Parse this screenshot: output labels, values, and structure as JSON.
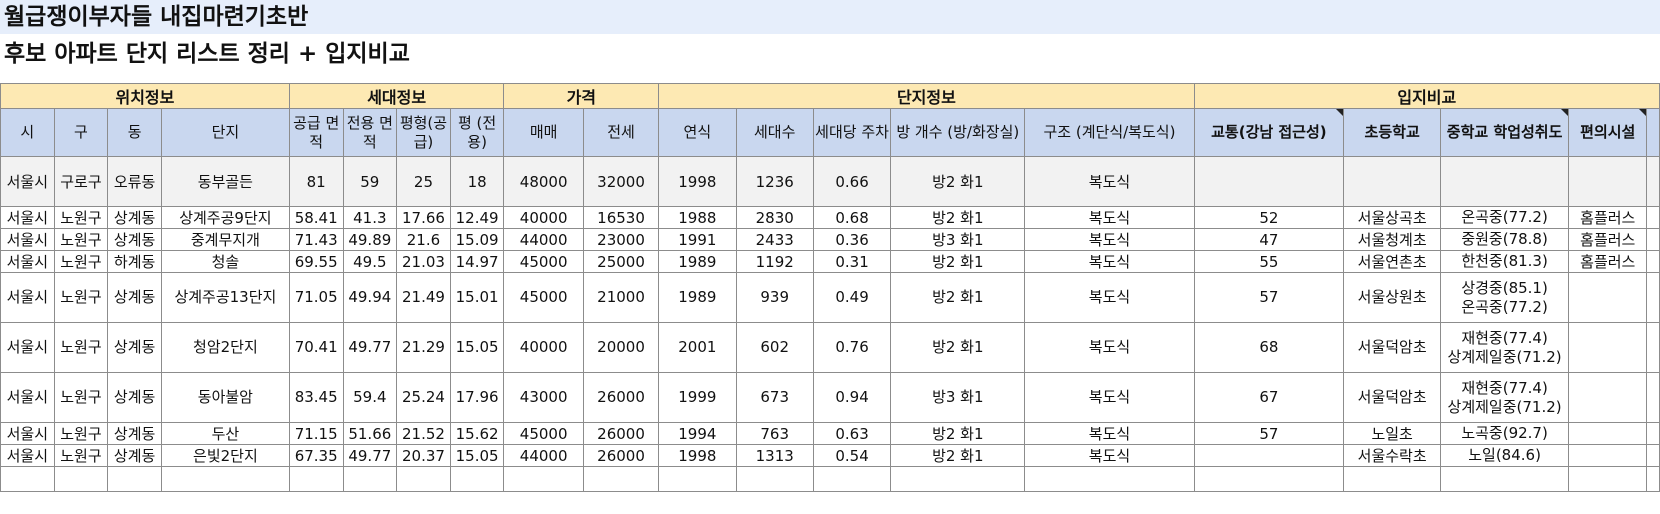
{
  "sheet": {
    "title1": "월급쟁이부자들 내집마련기초반",
    "title2": "후보 아파트 단지 리스트 정리 + 입지비교"
  },
  "groups": {
    "location": "위치정보",
    "household": "세대정보",
    "price": "가격",
    "complex": "단지정보",
    "compare": "입지비교"
  },
  "headers": {
    "si": "시",
    "gu": "구",
    "dong": "동",
    "danji": "단지",
    "supply_area": "공급 면적",
    "exclusive_area": "전용 면적",
    "pyeong_supply": "평형(공급)",
    "pyeong_exclusive": "평 (전용)",
    "sale": "매매",
    "jeonse": "전세",
    "year": "연식",
    "households": "세대수",
    "parking": "세대당 주차",
    "rooms": "방 개수 (방/화장실)",
    "structure": "구조 (계단식/복도식)",
    "transport": "교통(강남 접근성)",
    "elementary": "초등학교",
    "middle": "중학교 학업성취도",
    "convenience": "편의시설"
  },
  "rows": [
    {
      "si": "서울시",
      "gu": "구로구",
      "dong": "오류동",
      "danji": "동부골든",
      "supply": "81",
      "excl": "59",
      "pys": "25",
      "pye": "18",
      "sale": "48000",
      "jeonse": "32000",
      "year": "1998",
      "hh": "1236",
      "park": "0.66",
      "rooms": "방2 화1",
      "struct": "복도식",
      "trans": "",
      "elem": "",
      "mid1": "",
      "mid2": "",
      "conv": ""
    },
    {
      "si": "서울시",
      "gu": "노원구",
      "dong": "상계동",
      "danji": "상계주공9단지",
      "supply": "58.41",
      "excl": "41.3",
      "pys": "17.66",
      "pye": "12.49",
      "sale": "40000",
      "jeonse": "16530",
      "year": "1988",
      "hh": "2830",
      "park": "0.68",
      "rooms": "방2 화1",
      "struct": "복도식",
      "trans": "52",
      "elem": "서울상곡초",
      "mid1": "온곡중(77.2)",
      "mid2": "",
      "conv": "홈플러스"
    },
    {
      "si": "서울시",
      "gu": "노원구",
      "dong": "상계동",
      "danji": "중계무지개",
      "supply": "71.43",
      "excl": "49.89",
      "pys": "21.6",
      "pye": "15.09",
      "sale": "44000",
      "jeonse": "23000",
      "year": "1991",
      "hh": "2433",
      "park": "0.36",
      "rooms": "방3 화1",
      "struct": "복도식",
      "trans": "47",
      "elem": "서울청계초",
      "mid1": "중원중(78.8)",
      "mid2": "",
      "conv": "홈플러스"
    },
    {
      "si": "서울시",
      "gu": "노원구",
      "dong": "하계동",
      "danji": "청솔",
      "supply": "69.55",
      "excl": "49.5",
      "pys": "21.03",
      "pye": "14.97",
      "sale": "45000",
      "jeonse": "25000",
      "year": "1989",
      "hh": "1192",
      "park": "0.31",
      "rooms": "방2 화1",
      "struct": "복도식",
      "trans": "55",
      "elem": "서울연촌초",
      "mid1": "한천중(81.3)",
      "mid2": "",
      "conv": "홈플러스"
    },
    {
      "si": "서울시",
      "gu": "노원구",
      "dong": "상계동",
      "danji": "상계주공13단지",
      "supply": "71.05",
      "excl": "49.94",
      "pys": "21.49",
      "pye": "15.01",
      "sale": "45000",
      "jeonse": "21000",
      "year": "1989",
      "hh": "939",
      "park": "0.49",
      "rooms": "방2 화1",
      "struct": "복도식",
      "trans": "57",
      "elem": "서울상원초",
      "mid1": "상경중(85.1)",
      "mid2": "온곡중(77.2)",
      "conv": ""
    },
    {
      "si": "서울시",
      "gu": "노원구",
      "dong": "상계동",
      "danji": "청암2단지",
      "supply": "70.41",
      "excl": "49.77",
      "pys": "21.29",
      "pye": "15.05",
      "sale": "40000",
      "jeonse": "20000",
      "year": "2001",
      "hh": "602",
      "park": "0.76",
      "rooms": "방2 화1",
      "struct": "복도식",
      "trans": "68",
      "elem": "서울덕암초",
      "mid1": "재현중(77.4)",
      "mid2": "상계제일중(71.2)",
      "conv": ""
    },
    {
      "si": "서울시",
      "gu": "노원구",
      "dong": "상계동",
      "danji": "동아불암",
      "supply": "83.45",
      "excl": "59.4",
      "pys": "25.24",
      "pye": "17.96",
      "sale": "43000",
      "jeonse": "26000",
      "year": "1999",
      "hh": "673",
      "park": "0.94",
      "rooms": "방3 화1",
      "struct": "복도식",
      "trans": "67",
      "elem": "서울덕암초",
      "mid1": "재현중(77.4)",
      "mid2": "상계제일중(71.2)",
      "conv": ""
    },
    {
      "si": "서울시",
      "gu": "노원구",
      "dong": "상계동",
      "danji": "두산",
      "supply": "71.15",
      "excl": "51.66",
      "pys": "21.52",
      "pye": "15.62",
      "sale": "45000",
      "jeonse": "26000",
      "year": "1994",
      "hh": "763",
      "park": "0.63",
      "rooms": "방2 화1",
      "struct": "복도식",
      "trans": "57",
      "elem": "노일초",
      "mid1": "노곡중(92.7)",
      "mid2": "",
      "conv": ""
    },
    {
      "si": "서울시",
      "gu": "노원구",
      "dong": "상계동",
      "danji": "은빛2단지",
      "supply": "67.35",
      "excl": "49.77",
      "pys": "20.37",
      "pye": "15.05",
      "sale": "44000",
      "jeonse": "26000",
      "year": "1998",
      "hh": "1313",
      "park": "0.54",
      "rooms": "방2 화1",
      "struct": "복도식",
      "trans": "",
      "elem": "서울수락초",
      "mid1": "노일(84.6)",
      "mid2": "",
      "conv": ""
    }
  ]
}
